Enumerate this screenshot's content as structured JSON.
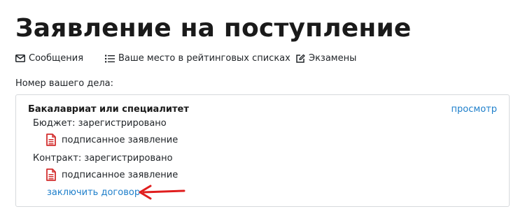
{
  "page": {
    "title": "Заявление на поступление"
  },
  "nav": {
    "messages": {
      "label": "Сообщения",
      "icon": "envelope-icon"
    },
    "rating": {
      "label": "Ваше место в рейтинговых списках",
      "icon": "list-icon"
    },
    "exams": {
      "label": "Экзамены",
      "icon": "edit-icon"
    }
  },
  "case_number_label": "Номер вашего дела:",
  "card": {
    "title": "Бакалавриат или специалитет",
    "view_link": "просмотр",
    "budget": {
      "status": "Бюджет: зарегистрировано",
      "document": "подписанное заявление"
    },
    "contract": {
      "status": "Контракт: зарегистрировано",
      "document": "подписанное заявление"
    },
    "contract_action": "заключить договор"
  },
  "colors": {
    "link": "#1e7fcb",
    "pdf_icon": "#d32f2f",
    "annotation_arrow": "#e01e1e",
    "card_border": "#d6d9dc"
  }
}
